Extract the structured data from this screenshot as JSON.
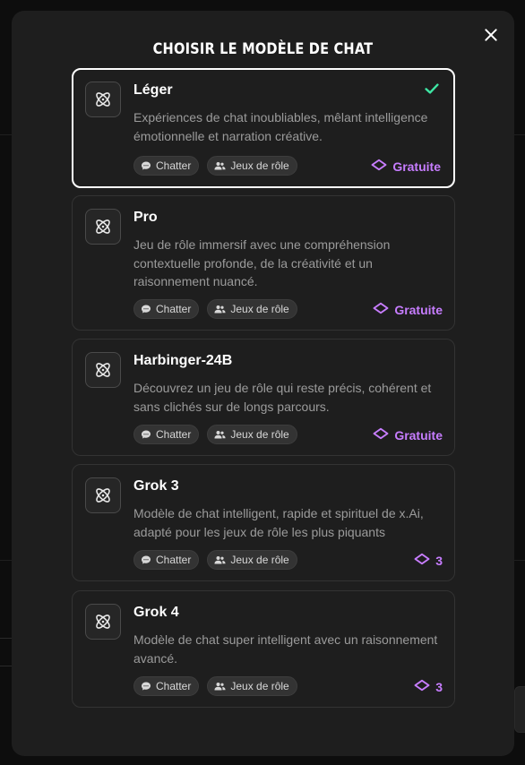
{
  "modal": {
    "title": "Choisir le modèle de chat",
    "close_label": "close"
  },
  "colors": {
    "accent_purple": "#c77dff",
    "check_green": "#3ee6a4",
    "card_bg": "#1e1e1e"
  },
  "models": [
    {
      "name": "Léger",
      "description": "Expériences de chat inoubliables, mêlant intelligence émotionnelle et narration créative.",
      "tags": [
        "Chatter",
        "Jeux de rôle"
      ],
      "price": "Gratuite",
      "selected": true
    },
    {
      "name": "Pro",
      "description": "Jeu de rôle immersif avec une compréhension contextuelle profonde, de la créativité et un raisonnement nuancé.",
      "tags": [
        "Chatter",
        "Jeux de rôle"
      ],
      "price": "Gratuite",
      "selected": false
    },
    {
      "name": "Harbinger-24B",
      "description": "Découvrez un jeu de rôle qui reste précis, cohérent et sans clichés sur de longs parcours.",
      "tags": [
        "Chatter",
        "Jeux de rôle"
      ],
      "price": "Gratuite",
      "selected": false
    },
    {
      "name": "Grok 3",
      "description": "Modèle de chat intelligent, rapide et spirituel de x.Ai, adapté pour les jeux de rôle les plus piquants",
      "tags": [
        "Chatter",
        "Jeux de rôle"
      ],
      "price": "3",
      "selected": false
    },
    {
      "name": "Grok 4",
      "description": "Modèle de chat super intelligent avec un raisonnement avancé.",
      "tags": [
        "Chatter",
        "Jeux de rôle"
      ],
      "price": "3",
      "selected": false
    }
  ],
  "icons": {
    "model": "atom-icon",
    "chat_tag": "chat-bubble-icon",
    "roleplay_tag": "users-icon",
    "price": "gem-icon",
    "selected": "checkmark-icon"
  }
}
